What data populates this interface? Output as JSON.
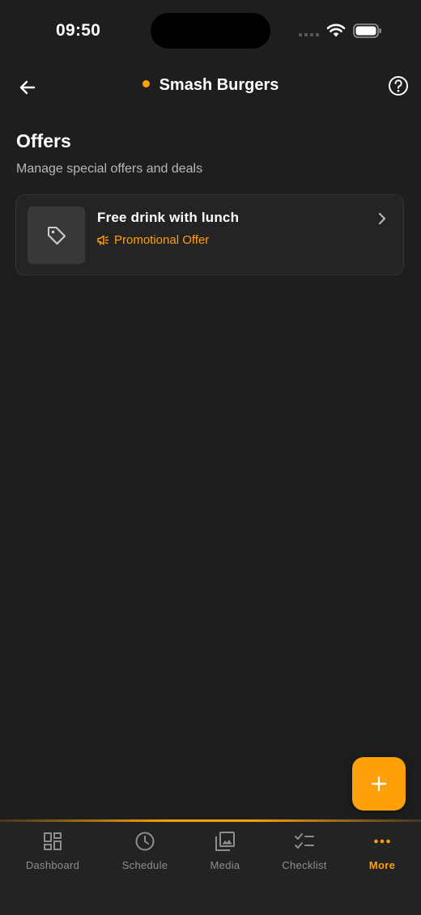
{
  "status_bar": {
    "time": "09:50"
  },
  "header": {
    "title": "Smash Burgers",
    "back_icon": "arrow-left-icon",
    "help_icon": "help-circle-icon",
    "status_dot_color": "#ff9f0a"
  },
  "page": {
    "title": "Offers",
    "subtitle": "Manage special offers and deals"
  },
  "offers": [
    {
      "title": "Free drink with lunch",
      "type_label": "Promotional Offer",
      "thumb_icon": "tag-icon",
      "type_icon": "megaphone-icon"
    }
  ],
  "fab": {
    "icon": "plus-icon"
  },
  "tabs": [
    {
      "label": "Dashboard",
      "icon": "dashboard-icon",
      "active": false
    },
    {
      "label": "Schedule",
      "icon": "clock-icon",
      "active": false
    },
    {
      "label": "Media",
      "icon": "media-icon",
      "active": false
    },
    {
      "label": "Checklist",
      "icon": "checklist-icon",
      "active": false
    },
    {
      "label": "More",
      "icon": "more-icon",
      "active": true
    }
  ],
  "colors": {
    "accent": "#ff9f0a",
    "background": "#1e1e1e",
    "card": "#242424",
    "tab_inactive": "#8e8e8e"
  }
}
